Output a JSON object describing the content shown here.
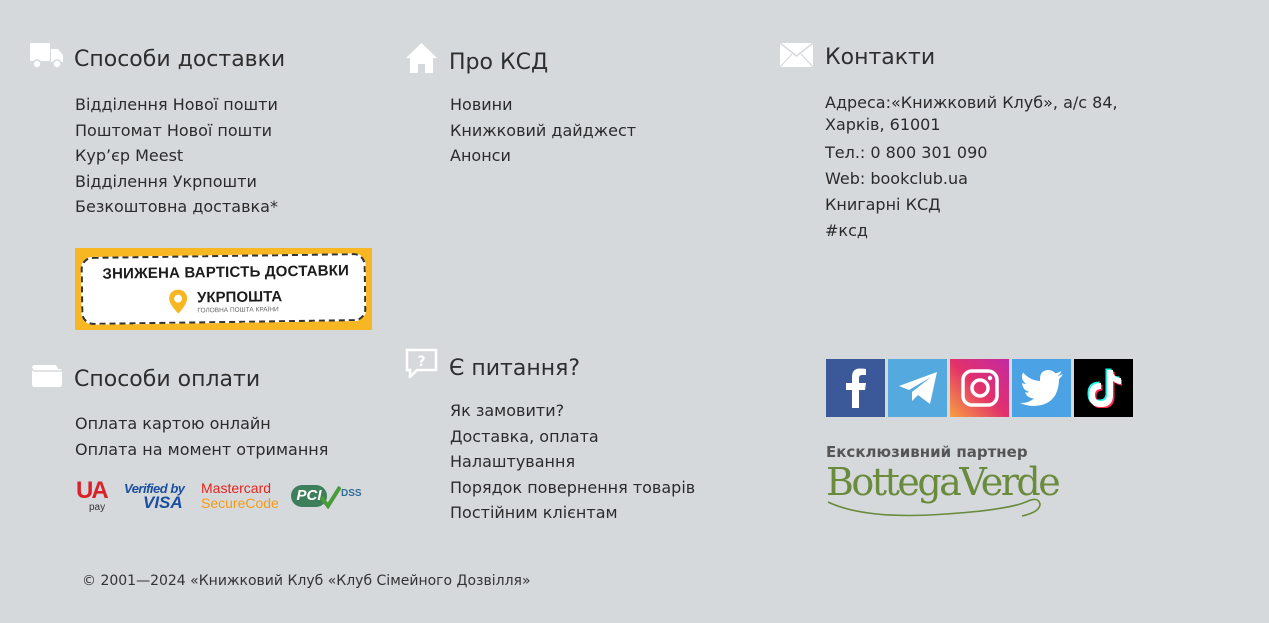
{
  "delivery": {
    "title": "Способи доставки",
    "icon": "truck-icon",
    "items": [
      "Відділення Нової пошти",
      "Поштомат Нової пошти",
      "Кур’єр Meest",
      "Відділення Укрпошти",
      "Безкоштовна доставка*"
    ]
  },
  "promo": {
    "line1": "ЗНИЖЕНА ВАРТІСТЬ ДОСТАВКИ",
    "brand": "УКРПОШТА",
    "tagline": "ГОЛОВНА ПОШТА КРАЇНИ",
    "bg_color": "#f6b723"
  },
  "payment": {
    "title": "Способи оплати",
    "icon": "wallet-icon",
    "items": [
      "Оплата картою онлайн",
      "Оплата на момент отримання"
    ],
    "logos": {
      "uapay_top": "UA",
      "uapay_bottom": "pay",
      "visa_top": "Verified by",
      "visa_bottom": "VISA",
      "mc_top": "Mastercard",
      "mc_bottom": "SecureCode",
      "pci": "PCI",
      "dss": "DSS"
    }
  },
  "about": {
    "title": "Про КСД",
    "icon": "home-icon",
    "items": [
      "Новини",
      "Книжковий дайджест",
      "Анонси"
    ]
  },
  "questions": {
    "title": "Є питання?",
    "icon": "question-bubble-icon",
    "items": [
      "Як замовити?",
      "Доставка, оплата",
      "Налаштування",
      "Порядок повернення товарів",
      "Постійним клієнтам"
    ]
  },
  "contacts": {
    "title": "Контакти",
    "icon": "envelope-icon",
    "address_line1": "Адреса:«Книжковий Клуб», а/с 84,",
    "address_line2": "Харків, 61001",
    "phone": "Тел.: 0 800 301 090",
    "web": "Web: bookclub.ua",
    "stores": "Книгарні КСД",
    "hashtag": "#ксд"
  },
  "social": [
    {
      "name": "facebook-icon",
      "color": "#3b5998"
    },
    {
      "name": "telegram-icon",
      "color": "#54a9de"
    },
    {
      "name": "instagram-icon",
      "color": "#e1306c"
    },
    {
      "name": "twitter-icon",
      "color": "#4ba3e6"
    },
    {
      "name": "tiktok-icon",
      "color": "#000000"
    }
  ],
  "partner": {
    "title": "Ексклюзивний партнер",
    "brand": "BottegaVerde"
  },
  "copyright": "© 2001—2024 «Книжковий Клуб «Клуб Сімейного Дозвілля»"
}
